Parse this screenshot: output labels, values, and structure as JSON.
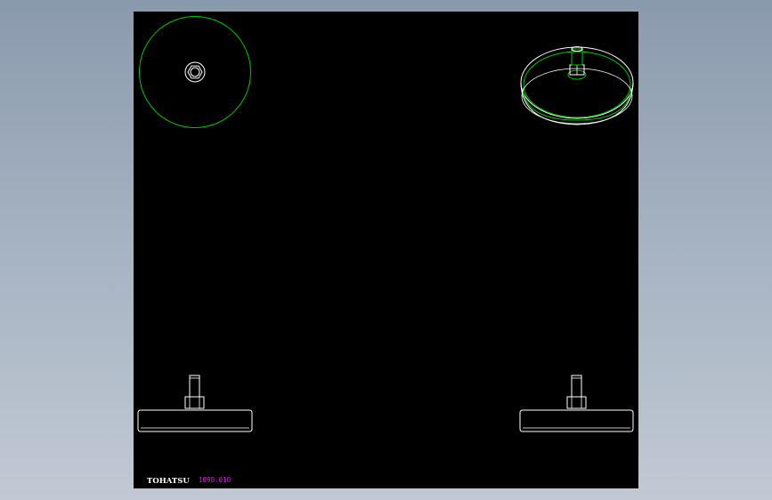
{
  "drawing": {
    "brand_label": "TOHATSU",
    "part_number": "1090.010",
    "colors": {
      "background_outer": "#9aa8b8",
      "canvas": "#000000",
      "line_white": "#ffffff",
      "line_green": "#00c800",
      "text_white": "#ffffff",
      "text_magenta": "#ff00ff"
    },
    "views": [
      {
        "name": "top-view",
        "label": ""
      },
      {
        "name": "isometric-view",
        "label": ""
      },
      {
        "name": "front-view",
        "label": ""
      },
      {
        "name": "side-view",
        "label": ""
      }
    ]
  }
}
